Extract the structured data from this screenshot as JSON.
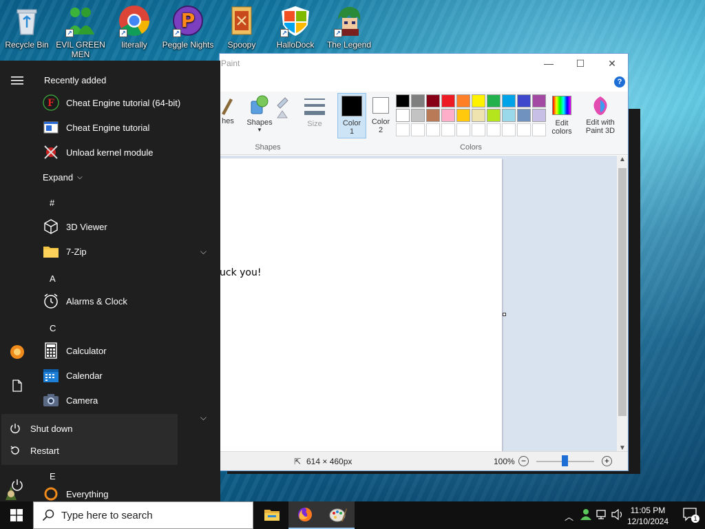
{
  "desktop": {
    "icons": [
      {
        "label": "Recycle Bin",
        "icon": "recycle-bin-icon"
      },
      {
        "label": "EVIL GREEN MEN",
        "icon": "evil-green-men-icon"
      },
      {
        "label": "literally",
        "icon": "chrome-icon"
      },
      {
        "label": "Peggle Nights",
        "icon": "peggle-icon"
      },
      {
        "label": "Spoopy",
        "icon": "spoopy-icon"
      },
      {
        "label": "HalloDock",
        "icon": "hallodock-icon"
      },
      {
        "label": "The Legend",
        "icon": "legend-icon"
      }
    ]
  },
  "paint": {
    "title_partial": "Paint",
    "minimize": "—",
    "maximize": "☐",
    "close": "✕",
    "help": "?",
    "ribbon": {
      "brushes_partial": "hes",
      "shapes": "Shapes",
      "shapes_group": "Shapes",
      "size": "Size",
      "color1": "Color 1",
      "color1_line1": "Color",
      "color1_line2": "1",
      "color2_line1": "Color",
      "color2_line2": "2",
      "colors_group": "Colors",
      "edit_colors_line1": "Edit",
      "edit_colors_line2": "colors",
      "paint3d_line1": "Edit with",
      "paint3d_line2": "Paint 3D"
    },
    "palette_row1": [
      "#000000",
      "#7f7f7f",
      "#880015",
      "#ed1c24",
      "#ff7f27",
      "#fff200",
      "#22b14c",
      "#00a2e8",
      "#3f48cc",
      "#a349a4"
    ],
    "palette_row2": [
      "#ffffff",
      "#c3c3c3",
      "#b97a57",
      "#ffaec9",
      "#ffc90e",
      "#efe4b0",
      "#b5e61d",
      "#99d9ea",
      "#7092be",
      "#c8bfe7"
    ],
    "palette_row3": [
      "#ffffff",
      "#ffffff",
      "#ffffff",
      "#ffffff",
      "#ffffff",
      "#ffffff",
      "#ffffff",
      "#ffffff",
      "#ffffff",
      "#ffffff"
    ],
    "canvas_text_partial": "uck you!",
    "status": {
      "dimensions": "614 × 460px",
      "zoom": "100%",
      "zoom_minus": "−",
      "zoom_plus": "+"
    }
  },
  "start_menu": {
    "recently_added": "Recently added",
    "recent_apps": [
      {
        "label": "Cheat Engine tutorial (64-bit)",
        "icon": "cheat-engine-icon"
      },
      {
        "label": "Cheat Engine tutorial",
        "icon": "cheat-engine-tutorial-icon"
      },
      {
        "label": "Unload kernel module",
        "icon": "kernel-module-icon"
      }
    ],
    "expand": "Expand",
    "sections": {
      "hash": "#",
      "a": "A",
      "c": "C",
      "e": "E"
    },
    "apps": {
      "viewer3d": "3D Viewer",
      "zip": "7-Zip",
      "alarms": "Alarms & Clock",
      "calculator": "Calculator",
      "calendar": "Calendar",
      "camera": "Camera",
      "everything": "Everything"
    },
    "power": {
      "shutdown": "Shut down",
      "restart": "Restart"
    }
  },
  "taskbar": {
    "search_placeholder": "Type here to search",
    "time": "11:05 PM",
    "date": "12/10/2024",
    "notifications_count": "1"
  }
}
